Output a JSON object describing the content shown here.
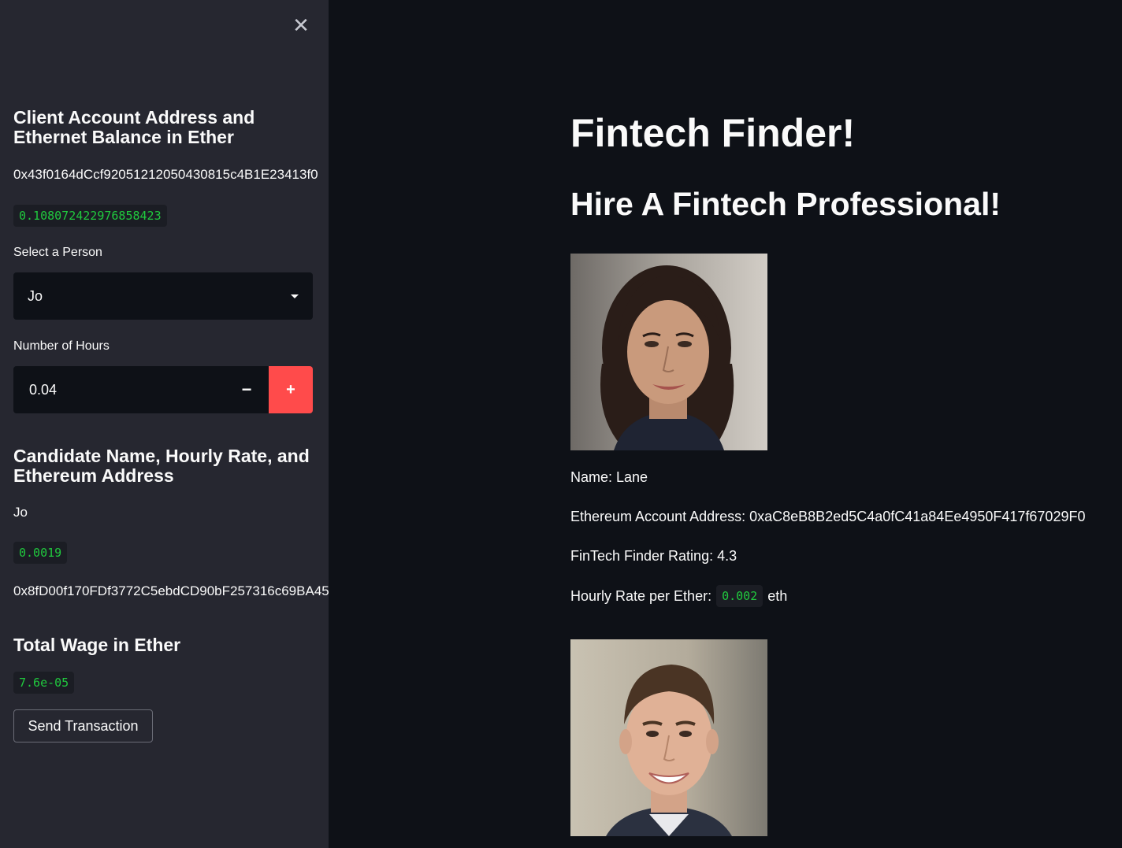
{
  "sidebar": {
    "close_icon": "close-icon",
    "client_heading": "Client Account Address and Ethernet Balance in Ether",
    "client_address": "0x43f0164dCcf92051212050430815c4B1E23413f0",
    "client_balance": "0.108072422976858423",
    "select_label": "Select a Person",
    "select_value": "Jo",
    "hours_label": "Number of Hours",
    "hours_value": "0.04",
    "minus_label": "−",
    "plus_label": "+",
    "candidate_heading": "Candidate Name, Hourly Rate, and Ethereum Address",
    "candidate_name": "Jo",
    "candidate_rate": "0.0019",
    "candidate_address": "0x8fD00f170FDf3772C5ebdCD90bF257316c69BA45",
    "wage_heading": "Total Wage in Ether",
    "wage_value": "7.6e-05",
    "send_label": "Send Transaction"
  },
  "main": {
    "title": "Fintech Finder!",
    "subtitle": "Hire A Fintech Professional!",
    "profiles": [
      {
        "name_line": "Name: Lane",
        "address_line": "Ethereum Account Address: 0xaC8eB8B2ed5C4a0fC41a84Ee4950F417f67029F0",
        "rating_line": "FinTech Finder Rating: 4.3",
        "rate_prefix": "Hourly Rate per Ether:",
        "rate_value": "0.002",
        "rate_suffix": "eth"
      }
    ]
  },
  "colors": {
    "sidebar_bg": "#262730",
    "main_bg": "#0e1117",
    "accent": "#ff4b4b",
    "code_green": "#20c93e"
  }
}
